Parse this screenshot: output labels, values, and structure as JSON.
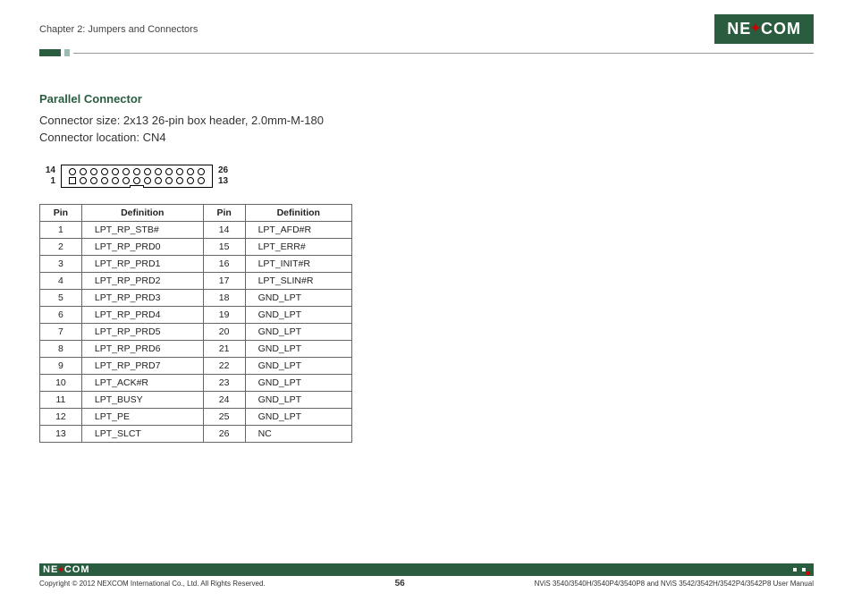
{
  "header": {
    "chapter": "Chapter 2: Jumpers and Connectors",
    "logo": "NE COM"
  },
  "section": {
    "title": "Parallel Connector",
    "size_line": "Connector size:  2x13 26-pin box header, 2.0mm-M-180",
    "location_line": "Connector location: CN4"
  },
  "diagram": {
    "top_left": "14",
    "bottom_left": "1",
    "top_right": "26",
    "bottom_right": "13"
  },
  "table": {
    "headers": {
      "pin": "Pin",
      "def": "Definition"
    },
    "rows": [
      {
        "p1": "1",
        "d1": "LPT_RP_STB#",
        "p2": "14",
        "d2": "LPT_AFD#R"
      },
      {
        "p1": "2",
        "d1": "LPT_RP_PRD0",
        "p2": "15",
        "d2": "LPT_ERR#"
      },
      {
        "p1": "3",
        "d1": "LPT_RP_PRD1",
        "p2": "16",
        "d2": "LPT_INIT#R"
      },
      {
        "p1": "4",
        "d1": "LPT_RP_PRD2",
        "p2": "17",
        "d2": "LPT_SLIN#R"
      },
      {
        "p1": "5",
        "d1": "LPT_RP_PRD3",
        "p2": "18",
        "d2": "GND_LPT"
      },
      {
        "p1": "6",
        "d1": "LPT_RP_PRD4",
        "p2": "19",
        "d2": "GND_LPT"
      },
      {
        "p1": "7",
        "d1": "LPT_RP_PRD5",
        "p2": "20",
        "d2": "GND_LPT"
      },
      {
        "p1": "8",
        "d1": "LPT_RP_PRD6",
        "p2": "21",
        "d2": "GND_LPT"
      },
      {
        "p1": "9",
        "d1": "LPT_RP_PRD7",
        "p2": "22",
        "d2": "GND_LPT"
      },
      {
        "p1": "10",
        "d1": "LPT_ACK#R",
        "p2": "23",
        "d2": "GND_LPT"
      },
      {
        "p1": "11",
        "d1": "LPT_BUSY",
        "p2": "24",
        "d2": "GND_LPT"
      },
      {
        "p1": "12",
        "d1": "LPT_PE",
        "p2": "25",
        "d2": "GND_LPT"
      },
      {
        "p1": "13",
        "d1": "LPT_SLCT",
        "p2": "26",
        "d2": "NC"
      }
    ]
  },
  "footer": {
    "copyright": "Copyright © 2012 NEXCOM International Co., Ltd. All Rights Reserved.",
    "page": "56",
    "doc": "NViS 3540/3540H/3540P4/3540P8 and NViS 3542/3542H/3542P4/3542P8 User Manual"
  }
}
